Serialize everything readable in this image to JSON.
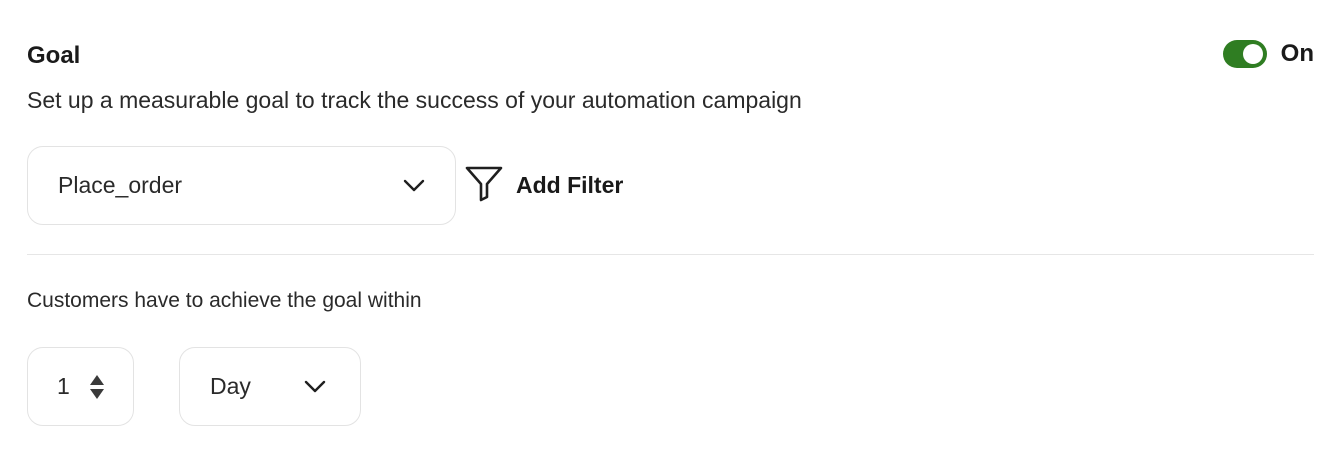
{
  "goal": {
    "title": "Goal",
    "description": "Set up a measurable goal to track the success of your automation campaign",
    "toggle": {
      "state": "on",
      "label": "On",
      "color": "#2f7d22"
    }
  },
  "event_select": {
    "value": "Place_order",
    "icon": "chevron-down-icon"
  },
  "filter": {
    "label": "Add Filter",
    "icon": "filter-icon"
  },
  "timeframe": {
    "label": "Customers have to achieve the goal within",
    "amount": "1",
    "unit": "Day",
    "stepper_icon": "stepper-icon"
  }
}
